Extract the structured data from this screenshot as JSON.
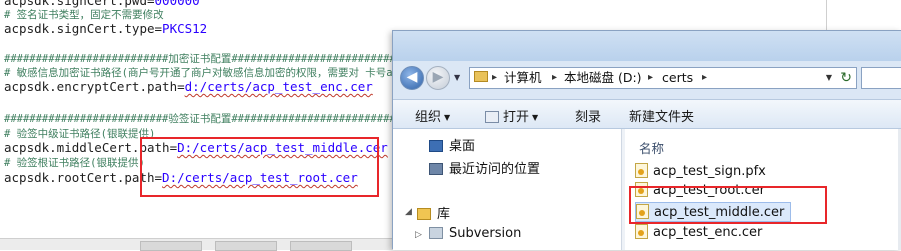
{
  "editor": {
    "lines": [
      {
        "key": "acpsdk.signCert.pwd=",
        "value": "000000"
      },
      {
        "comment": "# 签名证书类型，固定不需要修改"
      },
      {
        "key": "acpsdk.signCert.type=",
        "value": "PKCS12"
      },
      {
        "comment": "##########################加密证书配置##########################"
      },
      {
        "comment": "# 敏感信息加密证书路径(商户号开通了商户对敏感信息加密的权限，需要对 卡号accNo，pin和"
      },
      {
        "key": "acpsdk.encryptCert.path=",
        "value": "d:/certs/acp_test_enc.cer"
      },
      {
        "comment": "##########################验签证书配置##########################"
      },
      {
        "comment": "# 验签中级证书路径(银联提供)"
      },
      {
        "key": "acpsdk.middleCert.path=",
        "value": "D:/certs/acp_test_middle.cer"
      },
      {
        "comment": "# 验签根证书路径(银联提供)"
      },
      {
        "key": "acpsdk.rootCert.path=",
        "value": "D:/certs/acp_test_root.cer"
      }
    ]
  },
  "explorer": {
    "breadcrumb": [
      "计算机",
      "本地磁盘 (D:)",
      "certs"
    ],
    "toolbar": {
      "organize": "组织",
      "open": "打开",
      "burn": "刻录",
      "new_folder": "新建文件夹"
    },
    "nav": {
      "desktop": "桌面",
      "recent": "最近访问的位置",
      "library": "库",
      "subversion": "Subversion"
    },
    "list": {
      "column_name": "名称",
      "files": [
        "acp_test_sign.pfx",
        "acp_test_root.cer",
        "acp_test_middle.cer",
        "acp_test_enc.cer"
      ],
      "selected": "acp_test_middle.cer"
    }
  },
  "colors": {
    "highlight": "#e8262a",
    "comment": "#3f7f5f",
    "value": "#2a00ff"
  }
}
